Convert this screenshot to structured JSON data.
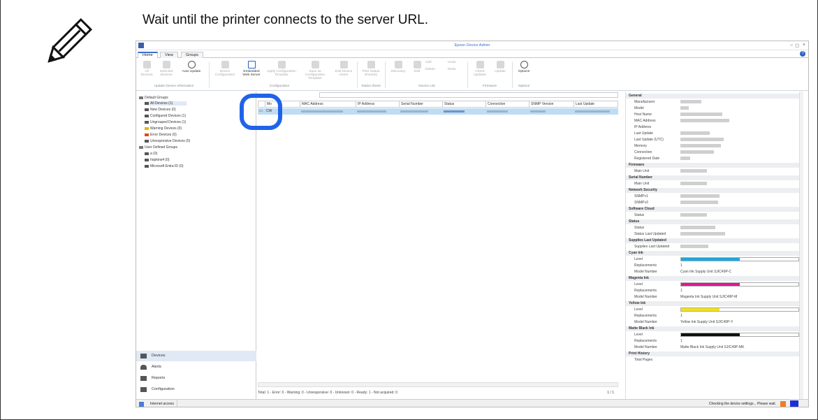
{
  "instruction": "Wait until the printer connects to the server URL.",
  "app": {
    "title": "Epson Device Admin",
    "tabs": [
      "Home",
      "View",
      "Groups"
    ],
    "ribbon": {
      "all_devices": "All Devices",
      "selected_devices": "Selected Devices",
      "auto_update": "Auto Update",
      "device_configuration": "Device Configuration",
      "embedded_web_server": "Embedded Web Server",
      "apply_configuration_template": "Apply Configuration Template",
      "save_configuration_template": "Save as Configuration Template",
      "edit_device_users": "Edit Device Users",
      "print_status_sheet": "Print Status Sheet(s)",
      "discovery": "Discovery",
      "edit": "Edit",
      "add": "Add",
      "delete": "Delete",
      "undo": "Undo",
      "redo": "Redo",
      "check_updates": "Check Updates",
      "update": "Update",
      "options": "Options",
      "groups": {
        "update_device_information": "Update Device Information",
        "configuration": "Configuration",
        "status_sheet": "Status Sheet",
        "device_list": "Device List",
        "firmware": "Firmware",
        "options": "Options"
      }
    },
    "tree": {
      "default_groups": "Default Groups",
      "all_devices": "All Devices (1)",
      "new_devices": "New Devices (0)",
      "configured_devices": "Configured Devices (1)",
      "ungrouped_devices": "Ungrouped Devices (1)",
      "warning_devices": "Warning Devices (0)",
      "error_devices": "Error Devices (0)",
      "unresponsive_devices": "Unresponsive Devices (0)",
      "user_defined_groups": "User Defined Groups",
      "group_a": "a (0)",
      "group_hopkins": "hopkins4 (0)",
      "group_entra": "Microsoft Entra ID (0)"
    },
    "nav": {
      "devices": "Devices",
      "alerts": "Alerts",
      "reports": "Reports",
      "configuration": "Configuration"
    },
    "grid": {
      "columns": [
        "Mo",
        "MAC Address",
        "IP Address",
        "Serial Number",
        "Status",
        "Connection",
        "SNMP Version",
        "Last Update"
      ],
      "row_model": "CW"
    },
    "grid_status": "Total: 1 - Error: 0 - Warning: 0 - Unresponsive: 0 - Unknown: 0 - Ready: 1 - Not acquired: 0",
    "pager": "1 / 1",
    "props": {
      "general": "General",
      "manufacturer": "Manufacturer",
      "model": "Model",
      "host_name": "Host Name",
      "mac_address": "MAC Address",
      "ip_address": "IP Address",
      "last_update": "Last Update",
      "last_update_utc": "Last Update (UTC)",
      "memory": "Memory",
      "connection": "Connection",
      "registered_date": "Registered Date",
      "firmware": "Firmware",
      "main_unit": "Main Unit",
      "serial_number": "Serial Number",
      "network_security": "Network Security",
      "snmpv1": "SNMPv1",
      "snmpv3": "SNMPv3",
      "software_cloud": "Software Cloud",
      "status": "Status",
      "status_last_updated": "Status Last Updated",
      "supplies_last_updated": "Supplies Last Updated",
      "cyan_ink": "Cyan Ink",
      "magenta_ink": "Magenta Ink",
      "yellow_ink": "Yellow Ink",
      "matte_black_ink": "Matte Black Ink",
      "print_history": "Print History",
      "level": "Level",
      "replacements": "Replacements",
      "model_number": "Model Number",
      "cyan_replacements": "1",
      "cyan_model": "Cyan Ink Supply Unit SJIC49P-C",
      "magenta_replacements": "1",
      "magenta_model": "Magenta Ink Supply Unit SJIC49P-M",
      "yellow_replacements": "1",
      "yellow_model": "Yellow Ink Supply Unit SJIC49P-Y",
      "black_replacements": "1",
      "black_model": "Matte Black Ink Supply Unit SJIC49P-MK",
      "total_pages": "Total Pages"
    },
    "ink_levels": {
      "cyan": 0.5,
      "magenta": 0.5,
      "yellow": 0.33,
      "matte_black": 0.5
    },
    "colors": {
      "cyan": "#1ea6dd",
      "magenta": "#e01694",
      "yellow": "#f2e11a",
      "matte_black": "#111111",
      "accent": "#1f63e9"
    },
    "statusbar": {
      "internet_access": "Internet access",
      "message": "Checking the device settings... Please wait."
    }
  }
}
